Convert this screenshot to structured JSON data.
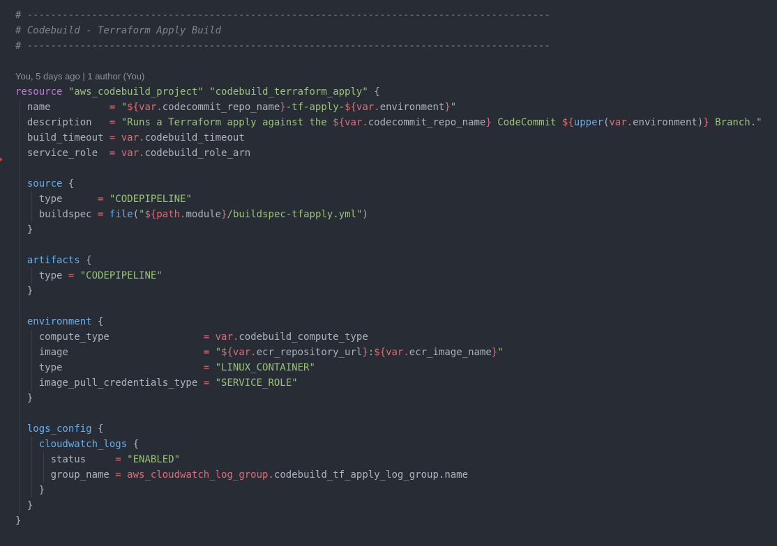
{
  "editor": {
    "blame_annotation": "You, 5 days ago | 1 author (You)",
    "lines": [
      [
        {
          "c": "comment",
          "t": "# -----------------------------------------------------------------------------------------"
        }
      ],
      [
        {
          "c": "comment",
          "t": "# Codebuild - Terraform Apply Build"
        }
      ],
      [
        {
          "c": "comment",
          "t": "# -----------------------------------------------------------------------------------------"
        }
      ],
      [],
      [
        {
          "c": "blame",
          "t": "You, 5 days ago | 1 author (You)"
        }
      ],
      [
        {
          "c": "kw",
          "t": "resource"
        },
        {
          "c": "plain",
          "t": " "
        },
        {
          "c": "str",
          "t": "\"aws_codebuild_project\""
        },
        {
          "c": "plain",
          "t": " "
        },
        {
          "c": "str",
          "t": "\"codebuild_terraform_apply\""
        },
        {
          "c": "punct",
          "t": " {"
        }
      ],
      [
        {
          "c": "attr",
          "t": "  name          "
        },
        {
          "c": "op",
          "t": "="
        },
        {
          "c": "plain",
          "t": " "
        },
        {
          "c": "str",
          "t": "\""
        },
        {
          "c": "interp",
          "t": "${"
        },
        {
          "c": "var",
          "t": "var."
        },
        {
          "c": "plain",
          "t": "codecommit_repo_name"
        },
        {
          "c": "interp",
          "t": "}"
        },
        {
          "c": "str",
          "t": "-tf-apply-"
        },
        {
          "c": "interp",
          "t": "${"
        },
        {
          "c": "var",
          "t": "var."
        },
        {
          "c": "plain",
          "t": "environment"
        },
        {
          "c": "interp",
          "t": "}"
        },
        {
          "c": "str",
          "t": "\""
        }
      ],
      [
        {
          "c": "attr",
          "t": "  description   "
        },
        {
          "c": "op",
          "t": "="
        },
        {
          "c": "plain",
          "t": " "
        },
        {
          "c": "str",
          "t": "\"Runs a Terraform apply against the "
        },
        {
          "c": "interp",
          "t": "${"
        },
        {
          "c": "var",
          "t": "var."
        },
        {
          "c": "plain",
          "t": "codecommit_repo_name"
        },
        {
          "c": "interp",
          "t": "}"
        },
        {
          "c": "str",
          "t": " CodeCommit "
        },
        {
          "c": "interp",
          "t": "${"
        },
        {
          "c": "func",
          "t": "upper"
        },
        {
          "c": "punct",
          "t": "("
        },
        {
          "c": "var",
          "t": "var."
        },
        {
          "c": "plain",
          "t": "environment"
        },
        {
          "c": "punct",
          "t": ")"
        },
        {
          "c": "interp",
          "t": "}"
        },
        {
          "c": "str",
          "t": " Branch.\""
        }
      ],
      [
        {
          "c": "attr",
          "t": "  build_timeout "
        },
        {
          "c": "op",
          "t": "="
        },
        {
          "c": "plain",
          "t": " "
        },
        {
          "c": "var",
          "t": "var."
        },
        {
          "c": "plain",
          "t": "codebuild_timeout"
        }
      ],
      [
        {
          "c": "attr",
          "t": "  service_role  "
        },
        {
          "c": "op",
          "t": "="
        },
        {
          "c": "plain",
          "t": " "
        },
        {
          "c": "var",
          "t": "var."
        },
        {
          "c": "plain",
          "t": "codebuild_role_arn"
        }
      ],
      [],
      [
        {
          "c": "plain",
          "t": "  "
        },
        {
          "c": "block",
          "t": "source"
        },
        {
          "c": "punct",
          "t": " {"
        }
      ],
      [
        {
          "c": "attr",
          "t": "    type      "
        },
        {
          "c": "op",
          "t": "="
        },
        {
          "c": "plain",
          "t": " "
        },
        {
          "c": "str",
          "t": "\"CODEPIPELINE\""
        }
      ],
      [
        {
          "c": "attr",
          "t": "    buildspec "
        },
        {
          "c": "op",
          "t": "="
        },
        {
          "c": "plain",
          "t": " "
        },
        {
          "c": "func",
          "t": "file"
        },
        {
          "c": "punct",
          "t": "("
        },
        {
          "c": "str",
          "t": "\""
        },
        {
          "c": "interp",
          "t": "${"
        },
        {
          "c": "var",
          "t": "path."
        },
        {
          "c": "plain",
          "t": "module"
        },
        {
          "c": "interp",
          "t": "}"
        },
        {
          "c": "str",
          "t": "/buildspec-tfapply.yml\""
        },
        {
          "c": "punct",
          "t": ")"
        }
      ],
      [
        {
          "c": "punct",
          "t": "  }"
        }
      ],
      [],
      [
        {
          "c": "plain",
          "t": "  "
        },
        {
          "c": "block",
          "t": "artifacts"
        },
        {
          "c": "punct",
          "t": " {"
        }
      ],
      [
        {
          "c": "attr",
          "t": "    type "
        },
        {
          "c": "op",
          "t": "="
        },
        {
          "c": "plain",
          "t": " "
        },
        {
          "c": "str",
          "t": "\"CODEPIPELINE\""
        }
      ],
      [
        {
          "c": "punct",
          "t": "  }"
        }
      ],
      [],
      [
        {
          "c": "plain",
          "t": "  "
        },
        {
          "c": "block",
          "t": "environment"
        },
        {
          "c": "punct",
          "t": " {"
        }
      ],
      [
        {
          "c": "attr",
          "t": "    compute_type                "
        },
        {
          "c": "op",
          "t": "="
        },
        {
          "c": "plain",
          "t": " "
        },
        {
          "c": "var",
          "t": "var."
        },
        {
          "c": "plain",
          "t": "codebuild_compute_type"
        }
      ],
      [
        {
          "c": "attr",
          "t": "    image                       "
        },
        {
          "c": "op",
          "t": "="
        },
        {
          "c": "plain",
          "t": " "
        },
        {
          "c": "str",
          "t": "\""
        },
        {
          "c": "interp",
          "t": "${"
        },
        {
          "c": "var",
          "t": "var."
        },
        {
          "c": "plain",
          "t": "ecr_repository_url"
        },
        {
          "c": "interp",
          "t": "}"
        },
        {
          "c": "str",
          "t": ":"
        },
        {
          "c": "interp",
          "t": "${"
        },
        {
          "c": "var",
          "t": "var."
        },
        {
          "c": "plain",
          "t": "ecr_image_name"
        },
        {
          "c": "interp",
          "t": "}"
        },
        {
          "c": "str",
          "t": "\""
        }
      ],
      [
        {
          "c": "attr",
          "t": "    type                        "
        },
        {
          "c": "op",
          "t": "="
        },
        {
          "c": "plain",
          "t": " "
        },
        {
          "c": "str",
          "t": "\"LINUX_CONTAINER\""
        }
      ],
      [
        {
          "c": "attr",
          "t": "    image_pull_credentials_type "
        },
        {
          "c": "op",
          "t": "="
        },
        {
          "c": "plain",
          "t": " "
        },
        {
          "c": "str",
          "t": "\"SERVICE_ROLE\""
        }
      ],
      [
        {
          "c": "punct",
          "t": "  }"
        }
      ],
      [],
      [
        {
          "c": "plain",
          "t": "  "
        },
        {
          "c": "block",
          "t": "logs_config"
        },
        {
          "c": "punct",
          "t": " {"
        }
      ],
      [
        {
          "c": "plain",
          "t": "    "
        },
        {
          "c": "block",
          "t": "cloudwatch_logs"
        },
        {
          "c": "punct",
          "t": " {"
        }
      ],
      [
        {
          "c": "attr",
          "t": "      status     "
        },
        {
          "c": "op",
          "t": "="
        },
        {
          "c": "plain",
          "t": " "
        },
        {
          "c": "str",
          "t": "\"ENABLED\""
        }
      ],
      [
        {
          "c": "attr",
          "t": "      group_name "
        },
        {
          "c": "op",
          "t": "="
        },
        {
          "c": "plain",
          "t": " "
        },
        {
          "c": "var",
          "t": "aws_cloudwatch_log_group."
        },
        {
          "c": "plain",
          "t": "codebuild_tf_apply_log_group.name"
        }
      ],
      [
        {
          "c": "punct",
          "t": "    }"
        }
      ],
      [
        {
          "c": "punct",
          "t": "  }"
        }
      ],
      [
        {
          "c": "punct",
          "t": "}"
        }
      ]
    ]
  },
  "colors": {
    "background": "#282c34",
    "comment": "#7f848e",
    "keyword": "#c678dd",
    "string": "#98c379",
    "operator": "#e06c75",
    "block": "#61afef",
    "text": "#abb2bf"
  }
}
